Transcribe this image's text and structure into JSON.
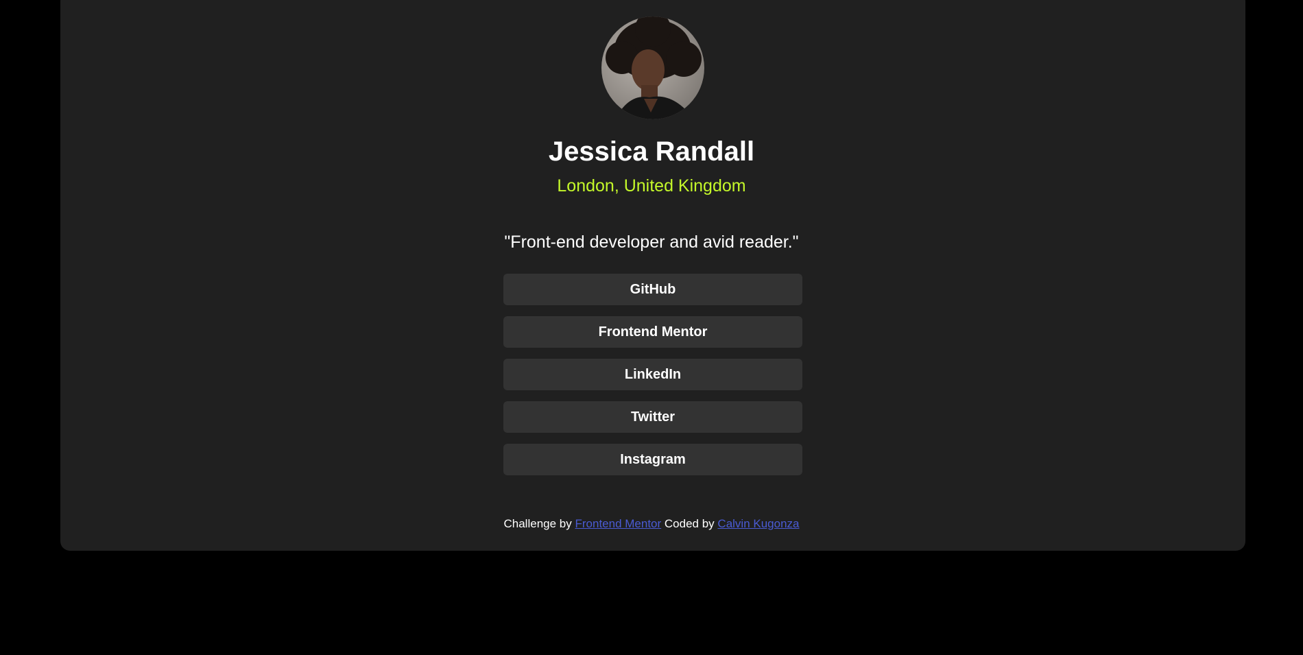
{
  "profile": {
    "name": "Jessica Randall",
    "location": "London, United Kingdom",
    "bio": "\"Front-end developer and avid reader.\"",
    "avatar_icon": "profile-photo"
  },
  "links": [
    {
      "label": "GitHub"
    },
    {
      "label": "Frontend Mentor"
    },
    {
      "label": "LinkedIn"
    },
    {
      "label": "Twitter"
    },
    {
      "label": "Instagram"
    }
  ],
  "footer": {
    "challenge_prefix": "Challenge by",
    "challenge_link": "Frontend Mentor",
    "coded_prefix": "Coded by",
    "coded_link": "Calvin Kugonza"
  },
  "colors": {
    "page_background": "#000000",
    "card_background": "#202020",
    "button_background": "#333333",
    "accent": "#c4f82a",
    "link": "#4a5bd4"
  }
}
